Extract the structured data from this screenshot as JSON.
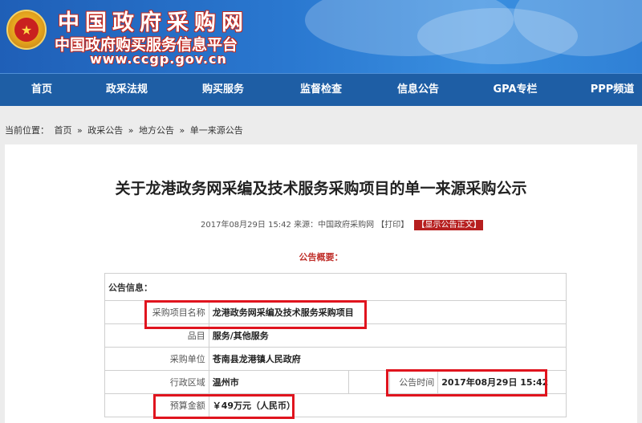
{
  "header": {
    "site_title": "中国政府采购网",
    "site_subtitle": "中国政府购买服务信息平台",
    "site_url": "www.ccgp.gov.cn",
    "emblem_icon": "national-emblem-icon"
  },
  "nav": {
    "items": [
      {
        "label": "首页"
      },
      {
        "label": "政采法规"
      },
      {
        "label": "购买服务"
      },
      {
        "label": "监督检查"
      },
      {
        "label": "信息公告"
      },
      {
        "label": "GPA专栏"
      },
      {
        "label": "PPP频道"
      }
    ]
  },
  "breadcrumb": {
    "prefix": "当前位置：",
    "items": [
      "首页",
      "政采公告",
      "地方公告",
      "单一来源公告"
    ],
    "separator": "»"
  },
  "article": {
    "title": "关于龙港政务网采编及技术服务采购项目的单一来源采购公示",
    "date": "2017年08月29日 15:42",
    "source": "来源：中国政府采购网",
    "print_label": "【打印】",
    "show_button": "【显示公告正文】",
    "summary_heading": "公告概要："
  },
  "info": {
    "section_label": "公告信息：",
    "project_name_label": "采购项目名称",
    "project_name": "龙港政务网采编及技术服务采购项目",
    "category_label": "品目",
    "category": "服务/其他服务",
    "unit_label": "采购单位",
    "unit": "苍南县龙港镇人民政府",
    "region_label": "行政区域",
    "region": "温州市",
    "time_label": "公告时间",
    "time": "2017年08月29日 15:42",
    "budget_label": "预算金额",
    "budget": "￥49万元（人民币）"
  },
  "colors": {
    "nav_bg": "#1e5ea5",
    "highlight": "#e0141e",
    "accent_red": "#c0302b"
  }
}
